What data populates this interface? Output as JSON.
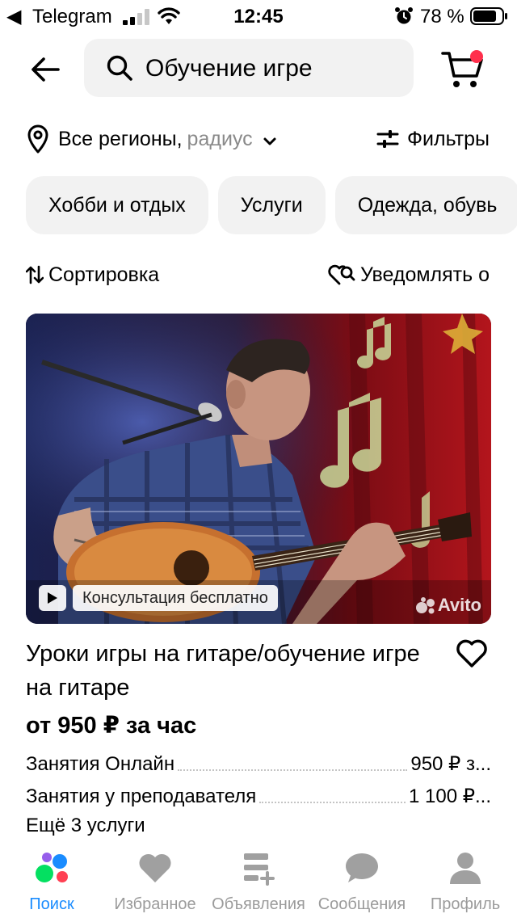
{
  "status_bar": {
    "back_glyph": "◀",
    "carrier": "Telegram",
    "time": "12:45",
    "battery_percent": "78 %"
  },
  "header": {
    "search_query": "Обучение игре"
  },
  "region": {
    "label": "Все регионы,",
    "radius": "радиус"
  },
  "filters": {
    "label": "Фильтры"
  },
  "chips": [
    "Хобби и отдых",
    "Услуги",
    "Одежда, обувь"
  ],
  "sort": {
    "label": "Сортировка"
  },
  "notify": {
    "label": "Уведомлять о"
  },
  "listing": {
    "badge": "Консультация бесплатно",
    "watermark": "Avito",
    "title": "Уроки игры на гитаре/обучение игре на гитаре",
    "price": "от 950 ₽ за час",
    "services": [
      {
        "name": "Занятия Онлайн",
        "price": "950 ₽ з..."
      },
      {
        "name": "Занятия у преподавателя",
        "price": "1 100 ₽..."
      }
    ],
    "more_services": "Ещё 3 услуги"
  },
  "bottom_nav": {
    "items": [
      {
        "label": "Поиск",
        "icon": "search-tab-icon",
        "active": true
      },
      {
        "label": "Избранное",
        "icon": "heart-icon",
        "active": false
      },
      {
        "label": "Объявления",
        "icon": "listings-icon",
        "active": false
      },
      {
        "label": "Сообщения",
        "icon": "chat-icon",
        "active": false
      },
      {
        "label": "Профиль",
        "icon": "profile-icon",
        "active": false
      }
    ]
  },
  "colors": {
    "accent_blue": "#1a8cff",
    "chip_bg": "#f2f2f2",
    "cart_badge": "#ff2f4c",
    "nav_inactive": "#9b9b9b"
  }
}
